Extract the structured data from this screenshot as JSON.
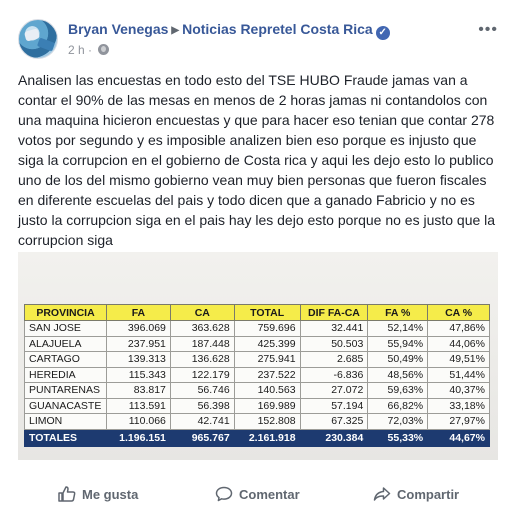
{
  "post": {
    "author": "Bryan Venegas",
    "target_page": "Noticias Repretel Costa Rica",
    "verified": true,
    "time": "2 h",
    "privacy_icon": "globe-icon",
    "more_icon": "more-options-icon",
    "more_glyph": "•••",
    "body": "Analisen las encuestas en todo esto del TSE HUBO Fraude jamas van a contar el 90% de las mesas en menos de 2 horas jamas ni contandolos con una maquina hicieron encuestas y que para hacer eso tenian que contar 278 votos por segundo y es imposible analizen bien eso porque es injusto que siga la corrupcion en el gobierno de Costa rica y aqui les dejo esto lo publico uno de los del mismo gobierno vean muy bien personas que fueron fiscales en diferente escuelas del pais y todo dicen que a ganado Fabricio y no es justo la corrupcion siga en el pais hay les dejo esto porque no es justo que la corrupcion siga"
  },
  "image_table": {
    "headers": [
      "PROVINCIA",
      "FA",
      "CA",
      "TOTAL",
      "DIF FA-CA",
      "FA %",
      "CA %"
    ],
    "rows": [
      [
        "SAN JOSE",
        "396.069",
        "363.628",
        "759.696",
        "32.441",
        "52,14%",
        "47,86%"
      ],
      [
        "ALAJUELA",
        "237.951",
        "187.448",
        "425.399",
        "50.503",
        "55,94%",
        "44,06%"
      ],
      [
        "CARTAGO",
        "139.313",
        "136.628",
        "275.941",
        "2.685",
        "50,49%",
        "49,51%"
      ],
      [
        "HEREDIA",
        "115.343",
        "122.179",
        "237.522",
        "-6.836",
        "48,56%",
        "51,44%"
      ],
      [
        "PUNTARENAS",
        "83.817",
        "56.746",
        "140.563",
        "27.072",
        "59,63%",
        "40,37%"
      ],
      [
        "GUANACASTE",
        "113.591",
        "56.398",
        "169.989",
        "57.194",
        "66,82%",
        "33,18%"
      ],
      [
        "LIMON",
        "110.066",
        "42.741",
        "152.808",
        "67.325",
        "72,03%",
        "27,97%"
      ]
    ],
    "total": [
      "TOTALES",
      "1.196.151",
      "965.767",
      "2.161.918",
      "230.384",
      "55,33%",
      "44,67%"
    ]
  },
  "actions": {
    "like": "Me gusta",
    "comment": "Comentar",
    "share": "Compartir"
  },
  "colors": {
    "link": "#385898",
    "muted": "#606770",
    "header_yellow": "#f5ec4a",
    "total_blue": "#1d3a70"
  }
}
